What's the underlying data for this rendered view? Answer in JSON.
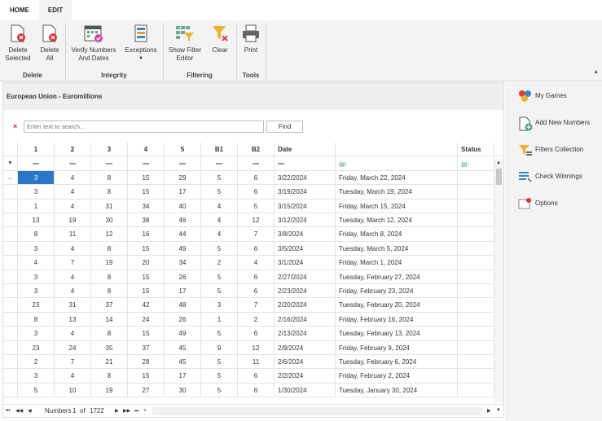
{
  "tabs": {
    "home": "HOME",
    "edit": "EDIT"
  },
  "ribbon": {
    "delete_selected": "Delete Selected",
    "delete_all": "Delete All",
    "group_delete": "Delete",
    "verify": "Verify Numbers And Dates",
    "exceptions": "Exceptions",
    "group_integrity": "Integrity",
    "show_filter": "Show Filter Editor",
    "clear": "Clear",
    "group_filtering": "Filtering",
    "print": "Print",
    "group_tools": "Tools"
  },
  "panel_title": "European Union - Euromillions",
  "search": {
    "placeholder": "Enter text to search...",
    "find": "Find"
  },
  "columns": [
    "1",
    "2",
    "3",
    "4",
    "5",
    "B1",
    "B2",
    "Date",
    "",
    "Status"
  ],
  "rows": [
    [
      "3",
      "4",
      "8",
      "15",
      "29",
      "5",
      "6",
      "3/22/2024",
      "Friday, March 22, 2024"
    ],
    [
      "3",
      "4",
      "8",
      "15",
      "17",
      "5",
      "6",
      "3/19/2024",
      "Tuesday, March 19, 2024"
    ],
    [
      "1",
      "4",
      "31",
      "34",
      "40",
      "4",
      "5",
      "3/15/2024",
      "Friday, March 15, 2024"
    ],
    [
      "13",
      "19",
      "30",
      "38",
      "46",
      "4",
      "12",
      "3/12/2024",
      "Tuesday, March 12, 2024"
    ],
    [
      "8",
      "11",
      "12",
      "16",
      "44",
      "4",
      "7",
      "3/8/2024",
      "Friday, March 8, 2024"
    ],
    [
      "3",
      "4",
      "8",
      "15",
      "49",
      "5",
      "6",
      "3/5/2024",
      "Tuesday, March 5, 2024"
    ],
    [
      "4",
      "7",
      "19",
      "20",
      "34",
      "2",
      "4",
      "3/1/2024",
      "Friday, March 1, 2024"
    ],
    [
      "3",
      "4",
      "8",
      "15",
      "26",
      "5",
      "6",
      "2/27/2024",
      "Tuesday, February 27, 2024"
    ],
    [
      "3",
      "4",
      "8",
      "15",
      "17",
      "5",
      "6",
      "2/23/2024",
      "Friday, February 23, 2024"
    ],
    [
      "23",
      "31",
      "37",
      "42",
      "48",
      "3",
      "7",
      "2/20/2024",
      "Tuesday, February 20, 2024"
    ],
    [
      "8",
      "13",
      "14",
      "24",
      "26",
      "1",
      "2",
      "2/16/2024",
      "Friday, February 16, 2024"
    ],
    [
      "3",
      "4",
      "8",
      "15",
      "49",
      "5",
      "6",
      "2/13/2024",
      "Tuesday, February 13, 2024"
    ],
    [
      "23",
      "24",
      "35",
      "37",
      "45",
      "9",
      "12",
      "2/9/2024",
      "Friday, February 9, 2024"
    ],
    [
      "2",
      "7",
      "21",
      "28",
      "45",
      "5",
      "11",
      "2/6/2024",
      "Tuesday, February 6, 2024"
    ],
    [
      "3",
      "4",
      "8",
      "15",
      "17",
      "5",
      "6",
      "2/2/2024",
      "Friday, February 2, 2024"
    ],
    [
      "5",
      "10",
      "19",
      "27",
      "30",
      "5",
      "6",
      "1/30/2024",
      "Tuesday, January 30, 2024"
    ]
  ],
  "footer": {
    "label": "Numbers",
    "page": "1",
    "of": "of",
    "total": "1722"
  },
  "sidebar": {
    "items": [
      "My Games",
      "Add New Numbers",
      "Filters Collection",
      "Check Winnings",
      "Options"
    ]
  }
}
